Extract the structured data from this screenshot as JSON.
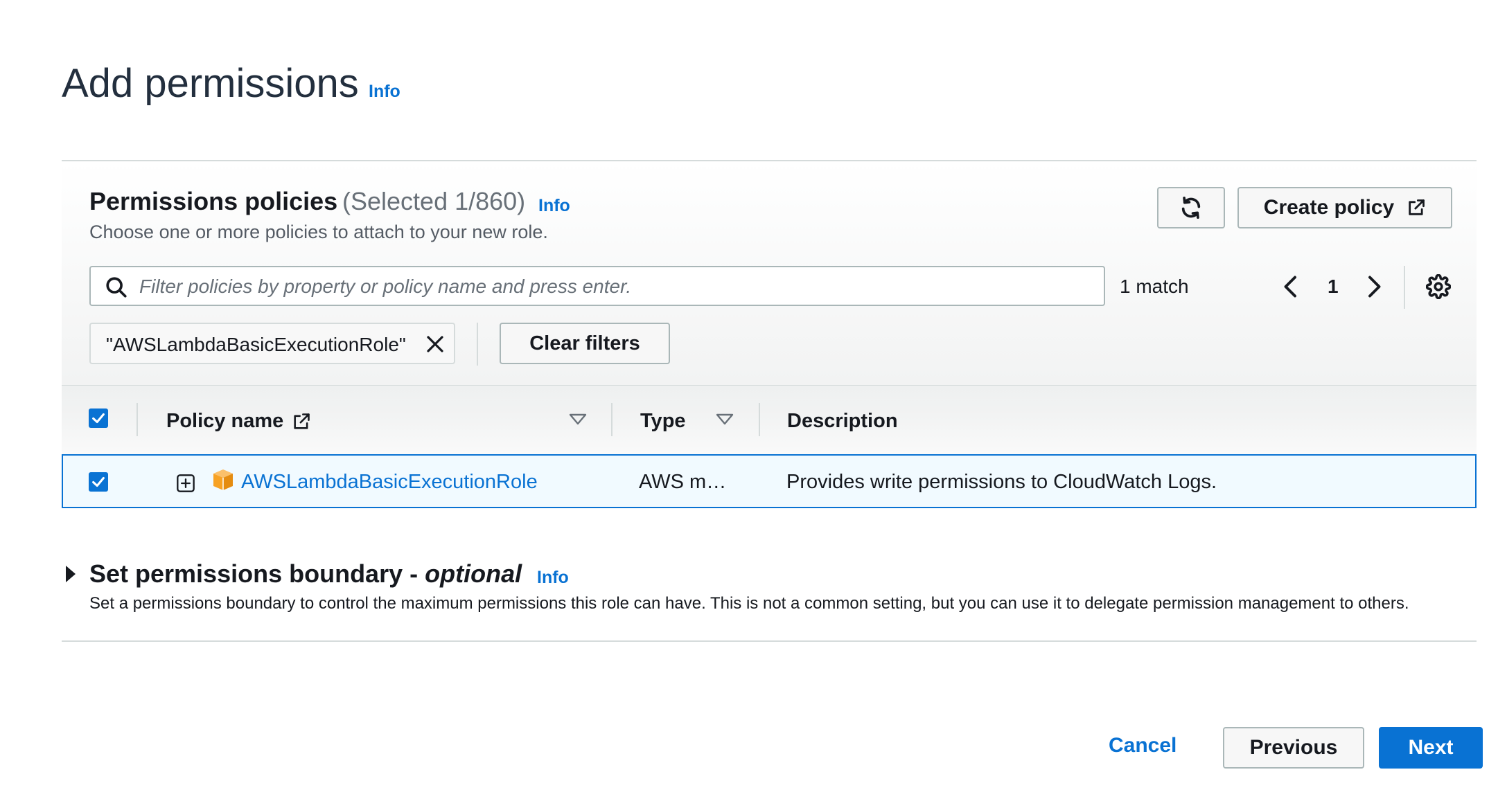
{
  "page": {
    "title": "Add permissions",
    "info_label": "Info"
  },
  "policies": {
    "title": "Permissions policies",
    "selected_count": "(Selected 1/860)",
    "info_label": "Info",
    "description": "Choose one or more policies to attach to your new role.",
    "create_policy_label": "Create policy",
    "search": {
      "placeholder": "Filter policies by property or policy name and press enter.",
      "value": ""
    },
    "match_count": "1 match",
    "current_page": "1",
    "filter_token": "\"AWSLambdaBasicExecutionRole\"",
    "clear_filters_label": "Clear filters",
    "columns": {
      "policy_name": "Policy name",
      "type": "Type",
      "description": "Description"
    },
    "rows": [
      {
        "name": "AWSLambdaBasicExecutionRole",
        "type": "AWS m…",
        "description": "Provides write permissions to CloudWatch Logs.",
        "selected": true
      }
    ]
  },
  "boundary": {
    "title": "Set permissions boundary -",
    "title_optional": "optional",
    "info_label": "Info",
    "description": "Set a permissions boundary to control the maximum permissions this role can have. This is not a common setting, but you can use it to delegate permission management to others."
  },
  "footer": {
    "cancel_label": "Cancel",
    "previous_label": "Previous",
    "next_label": "Next"
  },
  "colors": {
    "primary": "#0972d3",
    "text": "#16191f",
    "secondary_text": "#545b64",
    "border": "#aab7b8",
    "selected_row_bg": "#f1faff",
    "package_icon": "#f7a224"
  },
  "icons": {
    "refresh": "refresh-icon",
    "external_link": "external-link-icon",
    "search": "search-icon",
    "pager_prev": "chevron-left-icon",
    "pager_next": "chevron-right-icon",
    "settings": "gear-icon",
    "dismiss": "close-icon",
    "sort": "caret-down-icon",
    "expand": "plus-square-icon",
    "policy_type": "package-icon",
    "expander": "caret-right-icon"
  }
}
